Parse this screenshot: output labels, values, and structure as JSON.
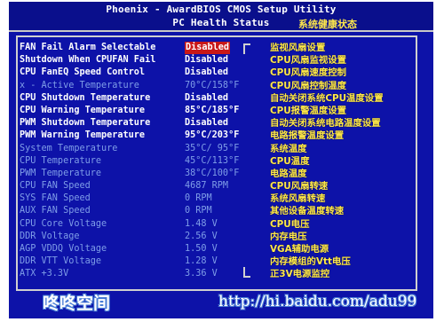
{
  "header": {
    "title_line1": "Phoenix - AwardBIOS CMOS Setup Utility",
    "title_line2": "PC Health Status",
    "title_cn": "系统健康状态"
  },
  "rows": [
    {
      "label": "FAN Fail Alarm Selectable",
      "value": "Disabled",
      "desc": "监视风扇设置",
      "state": "selected"
    },
    {
      "label": "Shutdown When CPUFAN Fail",
      "value": "Disabled",
      "desc": "CPU风扇监视设置",
      "state": "normal"
    },
    {
      "label": "CPU FanEQ Speed Control",
      "value": "Disabled",
      "desc": "CPU风扇速度控制",
      "state": "normal"
    },
    {
      "label": "x - Active Temperature",
      "value": "70°C/158°F",
      "desc": "CPU风扇控制温度",
      "state": "dim"
    },
    {
      "label": "CPU Shutdown Temperature",
      "value": "Disabled",
      "desc": "自动关闭系统CPU温度设置",
      "state": "normal"
    },
    {
      "label": "CPU Warning Temperature",
      "value": "85°C/185°F",
      "desc": "CPU报警温度设置",
      "state": "normal"
    },
    {
      "label": "PWM Shutdown Temperature",
      "value": "Disabled",
      "desc": "自动关闭系统电路温度设置",
      "state": "normal"
    },
    {
      "label": "PWM Warning Temperature",
      "value": "95°C/203°F",
      "desc": "电路报警温度设置",
      "state": "normal"
    },
    {
      "label": "System Temperature",
      "value": "35°C/ 95°F",
      "desc": "系统温度",
      "state": "dim"
    },
    {
      "label": "CPU Temperature",
      "value": "45°C/113°F",
      "desc": "CPU温度",
      "state": "dim"
    },
    {
      "label": "PWM Temperature",
      "value": "38°C/100°F",
      "desc": "电路温度",
      "state": "dim"
    },
    {
      "label": "CPU FAN Speed",
      "value": "4687 RPM",
      "desc": "CPU风扇转速",
      "state": "dim"
    },
    {
      "label": "SYS FAN Speed",
      "value": "0 RPM",
      "desc": "系统风扇转速",
      "state": "dim"
    },
    {
      "label": "AUX FAN Speed",
      "value": "0 RPM",
      "desc": "其他设备温度转速",
      "state": "dim"
    },
    {
      "label": "CPU Core Voltage",
      "value": "1.48 V",
      "desc": "CPU电压",
      "state": "dim"
    },
    {
      "label": "DDR Voltage",
      "value": "2.56 V",
      "desc": "内存电压",
      "state": "dim"
    },
    {
      "label": "AGP VDDQ Voltage",
      "value": "1.50 V",
      "desc": "VGA辅助电源",
      "state": "dim"
    },
    {
      "label": "DDR VTT Voltage",
      "value": "1.28 V",
      "desc": "内存模组的Vtt电压",
      "state": "dim"
    },
    {
      "label": "ATX +3.3V",
      "value": "3.36 V",
      "desc": "正3V电源监控",
      "state": "dim"
    }
  ],
  "watermark": {
    "left": "咚咚空间",
    "url": "http://hi.baidu.com/adu99"
  }
}
